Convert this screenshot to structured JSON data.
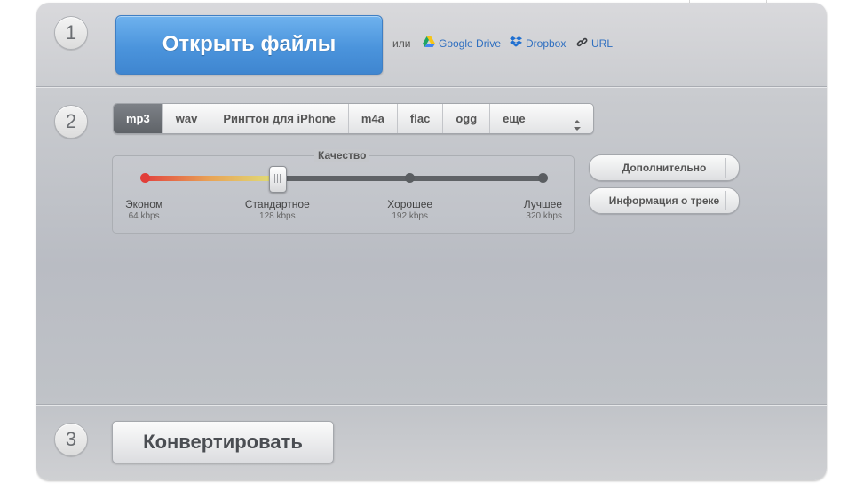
{
  "step1": {
    "number": "1",
    "open_label": "Открыть файлы",
    "or_label": "или",
    "links": [
      {
        "label": "Google Drive",
        "icon": "google-drive-icon"
      },
      {
        "label": "Dropbox",
        "icon": "dropbox-icon"
      },
      {
        "label": "URL",
        "icon": "link-icon"
      }
    ]
  },
  "step2": {
    "number": "2",
    "formats": [
      "mp3",
      "wav",
      "Рингтон для iPhone",
      "m4a",
      "flac",
      "ogg"
    ],
    "selected_format": "mp3",
    "more_label": "еще",
    "quality": {
      "title": "Качество",
      "selected_index": 1,
      "levels": [
        {
          "name": "Эконом",
          "kbps": "64 kbps"
        },
        {
          "name": "Стандартное",
          "kbps": "128 kbps"
        },
        {
          "name": "Хорошее",
          "kbps": "192 kbps"
        },
        {
          "name": "Лучшее",
          "kbps": "320 kbps"
        }
      ]
    },
    "advanced_label": "Дополнительно",
    "track_info_label": "Информация о треке"
  },
  "step3": {
    "number": "3",
    "convert_label": "Конвертировать"
  },
  "colors": {
    "open_button": "#4b94dc",
    "link": "#2f6fc0",
    "selected_format": "#6a6e73",
    "slider_fill_start": "#e2453f",
    "slider_fill_end": "#dfe07a"
  }
}
